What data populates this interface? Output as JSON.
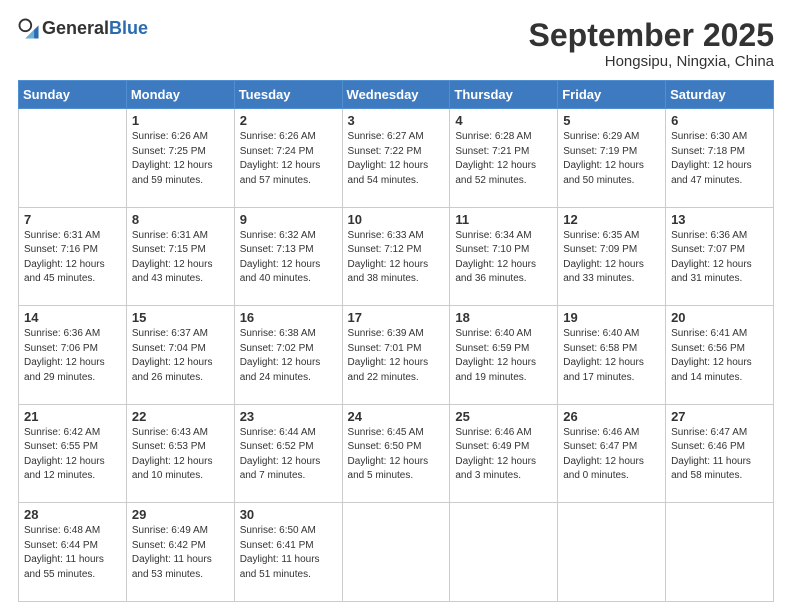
{
  "header": {
    "logo_line1": "General",
    "logo_line2": "Blue",
    "month": "September 2025",
    "location": "Hongsipu, Ningxia, China"
  },
  "weekdays": [
    "Sunday",
    "Monday",
    "Tuesday",
    "Wednesday",
    "Thursday",
    "Friday",
    "Saturday"
  ],
  "weeks": [
    [
      {
        "day": "",
        "info": ""
      },
      {
        "day": "1",
        "info": "Sunrise: 6:26 AM\nSunset: 7:25 PM\nDaylight: 12 hours\nand 59 minutes."
      },
      {
        "day": "2",
        "info": "Sunrise: 6:26 AM\nSunset: 7:24 PM\nDaylight: 12 hours\nand 57 minutes."
      },
      {
        "day": "3",
        "info": "Sunrise: 6:27 AM\nSunset: 7:22 PM\nDaylight: 12 hours\nand 54 minutes."
      },
      {
        "day": "4",
        "info": "Sunrise: 6:28 AM\nSunset: 7:21 PM\nDaylight: 12 hours\nand 52 minutes."
      },
      {
        "day": "5",
        "info": "Sunrise: 6:29 AM\nSunset: 7:19 PM\nDaylight: 12 hours\nand 50 minutes."
      },
      {
        "day": "6",
        "info": "Sunrise: 6:30 AM\nSunset: 7:18 PM\nDaylight: 12 hours\nand 47 minutes."
      }
    ],
    [
      {
        "day": "7",
        "info": "Sunrise: 6:31 AM\nSunset: 7:16 PM\nDaylight: 12 hours\nand 45 minutes."
      },
      {
        "day": "8",
        "info": "Sunrise: 6:31 AM\nSunset: 7:15 PM\nDaylight: 12 hours\nand 43 minutes."
      },
      {
        "day": "9",
        "info": "Sunrise: 6:32 AM\nSunset: 7:13 PM\nDaylight: 12 hours\nand 40 minutes."
      },
      {
        "day": "10",
        "info": "Sunrise: 6:33 AM\nSunset: 7:12 PM\nDaylight: 12 hours\nand 38 minutes."
      },
      {
        "day": "11",
        "info": "Sunrise: 6:34 AM\nSunset: 7:10 PM\nDaylight: 12 hours\nand 36 minutes."
      },
      {
        "day": "12",
        "info": "Sunrise: 6:35 AM\nSunset: 7:09 PM\nDaylight: 12 hours\nand 33 minutes."
      },
      {
        "day": "13",
        "info": "Sunrise: 6:36 AM\nSunset: 7:07 PM\nDaylight: 12 hours\nand 31 minutes."
      }
    ],
    [
      {
        "day": "14",
        "info": "Sunrise: 6:36 AM\nSunset: 7:06 PM\nDaylight: 12 hours\nand 29 minutes."
      },
      {
        "day": "15",
        "info": "Sunrise: 6:37 AM\nSunset: 7:04 PM\nDaylight: 12 hours\nand 26 minutes."
      },
      {
        "day": "16",
        "info": "Sunrise: 6:38 AM\nSunset: 7:02 PM\nDaylight: 12 hours\nand 24 minutes."
      },
      {
        "day": "17",
        "info": "Sunrise: 6:39 AM\nSunset: 7:01 PM\nDaylight: 12 hours\nand 22 minutes."
      },
      {
        "day": "18",
        "info": "Sunrise: 6:40 AM\nSunset: 6:59 PM\nDaylight: 12 hours\nand 19 minutes."
      },
      {
        "day": "19",
        "info": "Sunrise: 6:40 AM\nSunset: 6:58 PM\nDaylight: 12 hours\nand 17 minutes."
      },
      {
        "day": "20",
        "info": "Sunrise: 6:41 AM\nSunset: 6:56 PM\nDaylight: 12 hours\nand 14 minutes."
      }
    ],
    [
      {
        "day": "21",
        "info": "Sunrise: 6:42 AM\nSunset: 6:55 PM\nDaylight: 12 hours\nand 12 minutes."
      },
      {
        "day": "22",
        "info": "Sunrise: 6:43 AM\nSunset: 6:53 PM\nDaylight: 12 hours\nand 10 minutes."
      },
      {
        "day": "23",
        "info": "Sunrise: 6:44 AM\nSunset: 6:52 PM\nDaylight: 12 hours\nand 7 minutes."
      },
      {
        "day": "24",
        "info": "Sunrise: 6:45 AM\nSunset: 6:50 PM\nDaylight: 12 hours\nand 5 minutes."
      },
      {
        "day": "25",
        "info": "Sunrise: 6:46 AM\nSunset: 6:49 PM\nDaylight: 12 hours\nand 3 minutes."
      },
      {
        "day": "26",
        "info": "Sunrise: 6:46 AM\nSunset: 6:47 PM\nDaylight: 12 hours\nand 0 minutes."
      },
      {
        "day": "27",
        "info": "Sunrise: 6:47 AM\nSunset: 6:46 PM\nDaylight: 11 hours\nand 58 minutes."
      }
    ],
    [
      {
        "day": "28",
        "info": "Sunrise: 6:48 AM\nSunset: 6:44 PM\nDaylight: 11 hours\nand 55 minutes."
      },
      {
        "day": "29",
        "info": "Sunrise: 6:49 AM\nSunset: 6:42 PM\nDaylight: 11 hours\nand 53 minutes."
      },
      {
        "day": "30",
        "info": "Sunrise: 6:50 AM\nSunset: 6:41 PM\nDaylight: 11 hours\nand 51 minutes."
      },
      {
        "day": "",
        "info": ""
      },
      {
        "day": "",
        "info": ""
      },
      {
        "day": "",
        "info": ""
      },
      {
        "day": "",
        "info": ""
      }
    ]
  ]
}
